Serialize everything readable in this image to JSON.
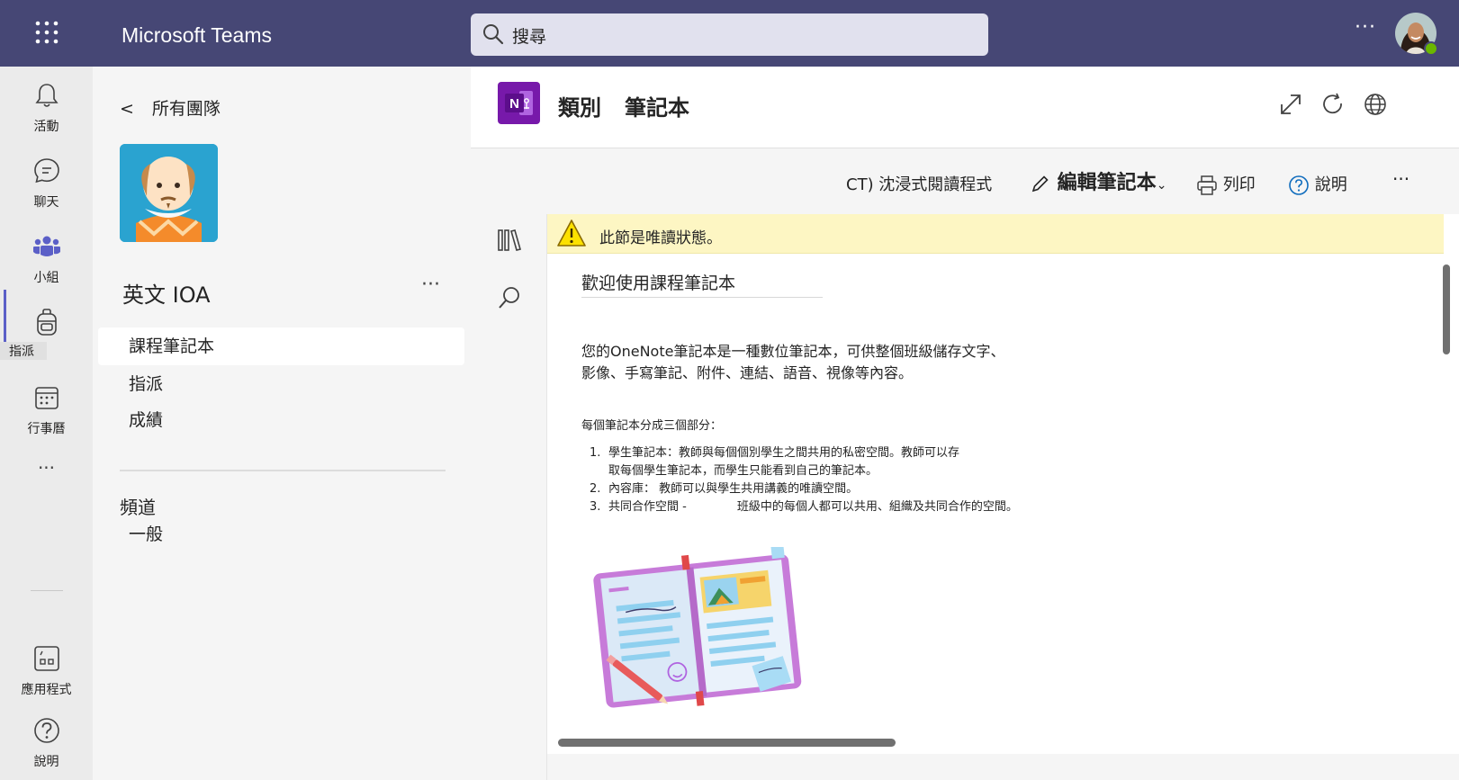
{
  "topbar": {
    "app_title": "Microsoft Teams",
    "search_placeholder": "搜尋",
    "more": "···"
  },
  "rail": {
    "items": [
      {
        "label": "活動",
        "icon": "bell-icon"
      },
      {
        "label": "聊天",
        "icon": "chat-icon"
      },
      {
        "label": "小組",
        "icon": "teams-icon"
      },
      {
        "label": "指派",
        "icon": "backpack-icon"
      },
      {
        "label": "行事曆",
        "icon": "calendar-icon"
      },
      {
        "label": "應用程式",
        "icon": "apps-icon"
      },
      {
        "label": "說明",
        "icon": "help-icon"
      }
    ],
    "more": "···",
    "active_color": "#5b5fc7"
  },
  "panel": {
    "back_label": "所有團隊",
    "team_name": "英文 IOA",
    "team_more": "···",
    "nav": [
      {
        "label": "課程筆記本"
      },
      {
        "label": "指派"
      },
      {
        "label": "成績"
      }
    ],
    "channels_label": "頻道",
    "channels": [
      {
        "label": "一般"
      }
    ]
  },
  "main": {
    "tab_category": "類別",
    "tab_name": "筆記本",
    "toolbar": {
      "reader": "CT) 沈浸式閱讀程式",
      "edit": "編輯筆記本",
      "print": "列印",
      "help": "說明",
      "more": "···"
    },
    "warning": "此節是唯讀狀態。",
    "page": {
      "title": "歡迎使用課程筆記本",
      "intro_line1": "您的OneNote筆記本是一種數位筆記本，可供整個班級儲存文字、",
      "intro_line2": "影像、手寫筆記、附件、連結、語音、視像等內容。",
      "sections_title": "每個筆記本分成三個部分：",
      "list": [
        {
          "num": "1.",
          "line1": "學生筆記本：教師與每個個別學生之間共用的私密空間。教師可以存",
          "line2": "取每個學生筆記本，而學生只能看到自己的筆記本。"
        },
        {
          "num": "2.",
          "line1": "內容庫： 教師可以與學生共用講義的唯讀空間。"
        },
        {
          "num": "3.",
          "line1a": "共同合作空間 -",
          "line1b": "班級中的每個人都可以共用、組織及共同合作的空間。"
        }
      ]
    }
  },
  "colors": {
    "topbar": "#464775",
    "onenote": "#7719aa",
    "warning_bg": "#fdf6c3"
  }
}
